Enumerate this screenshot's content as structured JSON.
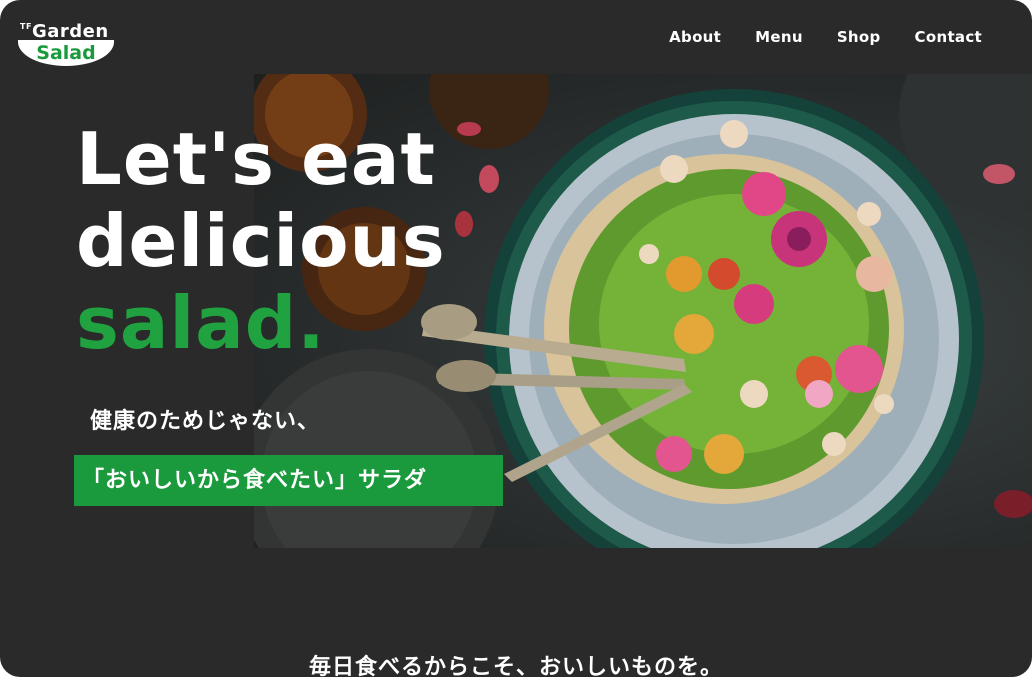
{
  "logo": {
    "tf": "TF",
    "top": "Garden",
    "bottom": "Salad"
  },
  "nav": {
    "items": [
      {
        "label": "About"
      },
      {
        "label": "Menu"
      },
      {
        "label": "Shop"
      },
      {
        "label": "Contact"
      }
    ]
  },
  "hero": {
    "headline_line1": "Let's eat",
    "headline_line2": "delicious",
    "headline_line3": "salad.",
    "tagline_1": "健康のためじゃない、",
    "tagline_2": "「おいしいから食べたい」サラダ"
  },
  "section": {
    "heading": "毎日食べるからこそ、おいしいものを。"
  },
  "colors": {
    "brand_green": "#1a9a3c",
    "background": "#2a2a2a",
    "text": "#ffffff"
  }
}
